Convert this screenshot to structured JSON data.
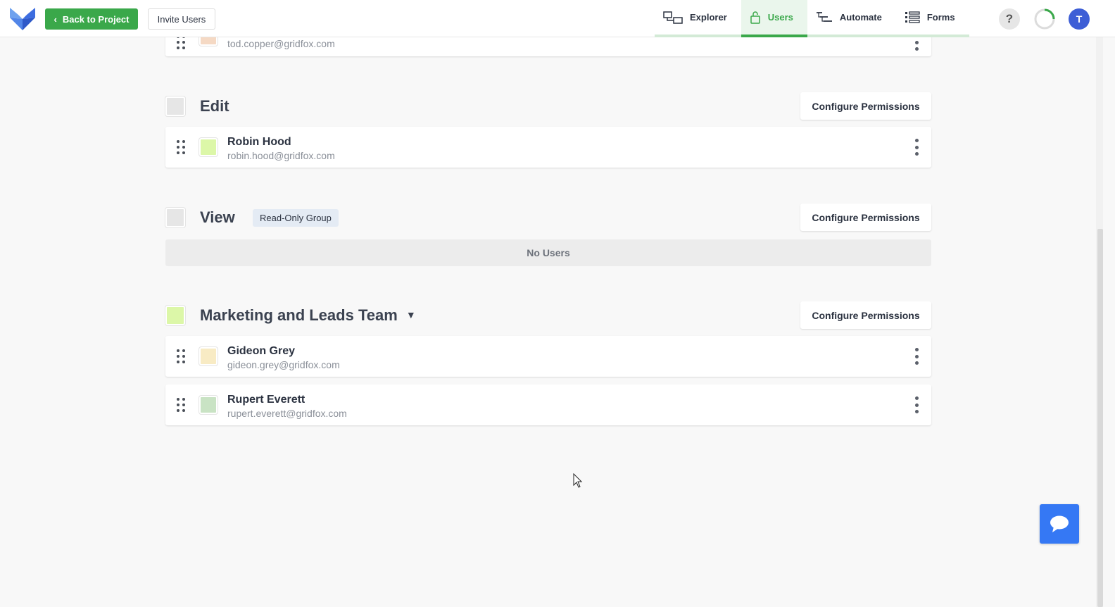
{
  "header": {
    "back_label": "Back to Project",
    "invite_label": "Invite Users",
    "tabs": [
      {
        "label": "Explorer",
        "icon": "explorer-icon",
        "active": false
      },
      {
        "label": "Users",
        "icon": "lock-icon",
        "active": true
      },
      {
        "label": "Automate",
        "icon": "automate-icon",
        "active": false
      },
      {
        "label": "Forms",
        "icon": "forms-icon",
        "active": false
      }
    ],
    "help_label": "?",
    "avatar_initial": "T"
  },
  "colors": {
    "brand_green": "#3aa84a",
    "accent_blue": "#3d5ed6",
    "chat_blue": "#3578f4"
  },
  "groups": [
    {
      "title": "",
      "partial": true,
      "users": [
        {
          "name": "",
          "email": "tod.copper@gridfox.com",
          "color": "#f5d9c4"
        }
      ]
    },
    {
      "title": "Edit",
      "configure_label": "Configure Permissions",
      "users": [
        {
          "name": "Robin Hood",
          "email": "robin.hood@gridfox.com",
          "color": "#dcf7a8"
        }
      ]
    },
    {
      "title": "View",
      "badge": "Read-Only Group",
      "configure_label": "Configure Permissions",
      "empty_label": "No Users",
      "users": []
    },
    {
      "title": "Marketing and Leads Team",
      "group_color": "#dcf7a8",
      "configure_label": "Configure Permissions",
      "users": [
        {
          "name": "Gideon Grey",
          "email": "gideon.grey@gridfox.com",
          "color": "#f8ebc4"
        },
        {
          "name": "Rupert Everett",
          "email": "rupert.everett@gridfox.com",
          "color": "#c9e3c4"
        }
      ]
    }
  ]
}
